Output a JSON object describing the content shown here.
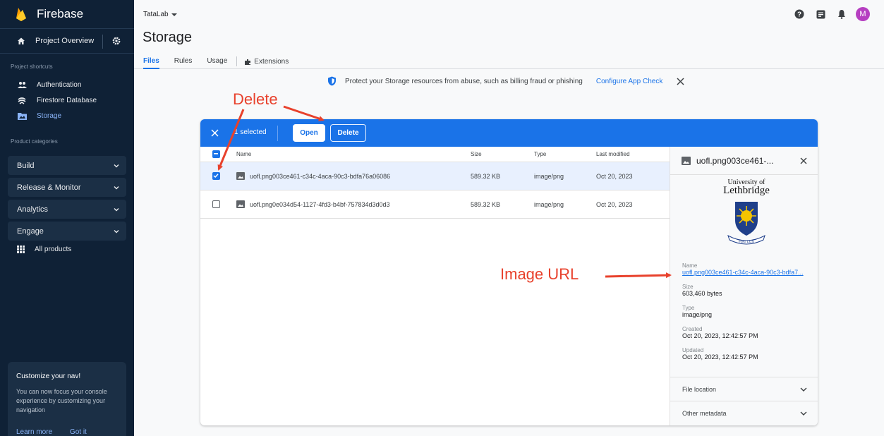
{
  "sidebar": {
    "brand": "Firebase",
    "overview": "Project Overview",
    "shortcuts_label": "Project shortcuts",
    "shortcuts": [
      {
        "label": "Authentication",
        "icon": "people-icon"
      },
      {
        "label": "Firestore Database",
        "icon": "firestore-icon"
      },
      {
        "label": "Storage",
        "icon": "storage-folder-icon",
        "active": true
      }
    ],
    "categories_label": "Product categories",
    "categories": [
      "Build",
      "Release & Monitor",
      "Analytics",
      "Engage"
    ],
    "all_products": "All products",
    "customize": {
      "title": "Customize your nav!",
      "desc": "You can now focus your console experience by customizing your navigation",
      "learn_more": "Learn more",
      "got_it": "Got it"
    }
  },
  "header": {
    "project": "TataLab",
    "title": "Storage",
    "tabs": [
      "Files",
      "Rules",
      "Usage",
      "Extensions"
    ],
    "avatar_letter": "M"
  },
  "banner": {
    "text": "Protect your Storage resources from abuse, such as billing fraud or phishing",
    "link": "Configure App Check"
  },
  "selection_bar": {
    "count": "1 selected",
    "open": "Open",
    "delete": "Delete"
  },
  "table": {
    "columns": [
      "Name",
      "Size",
      "Type",
      "Last modified"
    ],
    "rows": [
      {
        "name": "uofl.png003ce461-c34c-4aca-90c3-bdfa76a06086",
        "size": "589.32 KB",
        "type": "image/png",
        "modified": "Oct 20, 2023",
        "checked": true
      },
      {
        "name": "uofl.png0e034d54-1127-4fd3-b4bf-757834d3d0d3",
        "size": "589.32 KB",
        "type": "image/png",
        "modified": "Oct 20, 2023",
        "checked": false
      }
    ]
  },
  "details": {
    "title": "uofl.png003ce461-...",
    "preview_line1": "University of",
    "preview_line2": "Lethbridge",
    "preview_motto": "FIAT LUX",
    "name_label": "Name",
    "name_value": "uofl.png003ce461-c34c-4aca-90c3-bdfa7...",
    "size_label": "Size",
    "size_value": "603,460 bytes",
    "type_label": "Type",
    "type_value": "image/png",
    "created_label": "Created",
    "created_value": "Oct 20, 2023, 12:42:57 PM",
    "updated_label": "Updated",
    "updated_value": "Oct 20, 2023, 12:42:57 PM",
    "file_location": "File location",
    "other_metadata": "Other metadata"
  },
  "annotations": {
    "delete": "Delete",
    "image_url": "Image URL"
  },
  "colors": {
    "sidebar_bg": "#0f2136",
    "primary": "#1a73e8",
    "annotation": "#e8412c",
    "avatar": "#b63fc1"
  }
}
